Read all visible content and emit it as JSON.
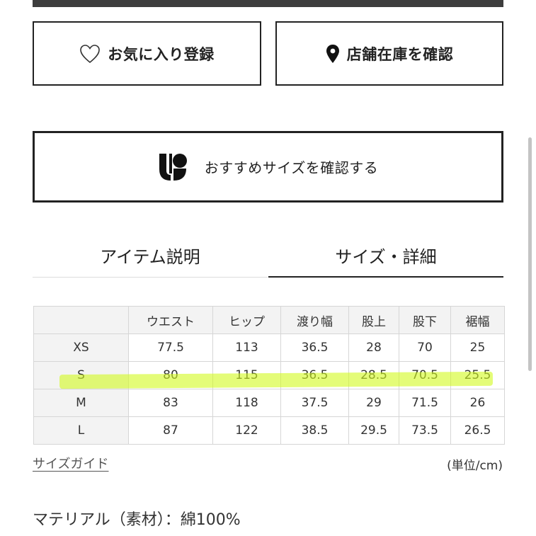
{
  "buttons": {
    "favorite": {
      "label": "お気に入り登録",
      "icon": "heart-outline-icon"
    },
    "store_stock": {
      "label": "店舗在庫を確認",
      "icon": "location-pin-icon"
    },
    "recommend_size": {
      "label": "おすすめサイズを確認する",
      "icon": "brand-logo-icon"
    }
  },
  "tabs": [
    {
      "label": "アイテム説明",
      "active": false
    },
    {
      "label": "サイズ・詳細",
      "active": true
    }
  ],
  "size_table": {
    "headers": [
      "",
      "ウエスト",
      "ヒップ",
      "渡り幅",
      "股上",
      "股下",
      "裾幅"
    ],
    "rows": [
      {
        "size": "XS",
        "values": [
          "77.5",
          "113",
          "36.5",
          "28",
          "70",
          "25"
        ]
      },
      {
        "size": "S",
        "values": [
          "80",
          "115",
          "36.5",
          "28.5",
          "70.5",
          "25.5"
        ]
      },
      {
        "size": "M",
        "values": [
          "83",
          "118",
          "37.5",
          "29",
          "71.5",
          "26"
        ]
      },
      {
        "size": "L",
        "values": [
          "87",
          "122",
          "38.5",
          "29.5",
          "73.5",
          "26.5"
        ]
      }
    ],
    "highlighted_row": "S",
    "highlight_color": "#d2fa1e"
  },
  "size_guide_link": "サイズガイド",
  "unit_note": "(単位/cm)",
  "material": "マテリアル（素材）：綿100%",
  "colors": {
    "text": "#222222",
    "border": "#d6d6d6",
    "header_bg": "#f3f3f3"
  }
}
